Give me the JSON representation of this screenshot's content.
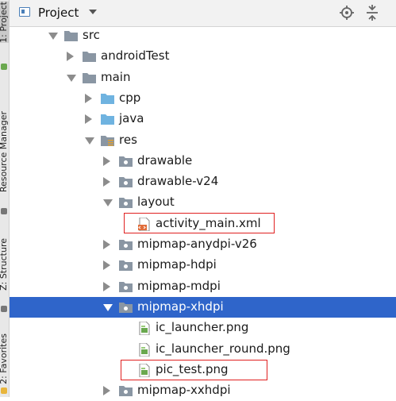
{
  "side_strip": {
    "project_label": "1: Project",
    "resource_label": "Resource Manager",
    "structure_label": "Z: Structure",
    "favorites_label": "2: Favorites"
  },
  "header": {
    "title": "Project",
    "icons": [
      "project-view-icon",
      "dropdown-caret-icon",
      "locate-file-icon",
      "collapse-all-icon"
    ]
  },
  "tree": [
    {
      "label": "src",
      "expanded": true,
      "kind": "folder"
    },
    {
      "label": "androidTest",
      "expanded": false,
      "kind": "folder"
    },
    {
      "label": "main",
      "expanded": true,
      "kind": "folder"
    },
    {
      "label": "cpp",
      "expanded": false,
      "kind": "source-folder"
    },
    {
      "label": "java",
      "expanded": false,
      "kind": "source-folder"
    },
    {
      "label": "res",
      "expanded": true,
      "kind": "resource-folder"
    },
    {
      "label": "drawable",
      "expanded": false,
      "kind": "package"
    },
    {
      "label": "drawable-v24",
      "expanded": false,
      "kind": "package"
    },
    {
      "label": "layout",
      "expanded": true,
      "kind": "package"
    },
    {
      "label": "activity_main.xml",
      "kind": "xml-file"
    },
    {
      "label": "mipmap-anydpi-v26",
      "expanded": false,
      "kind": "package"
    },
    {
      "label": "mipmap-hdpi",
      "expanded": false,
      "kind": "package"
    },
    {
      "label": "mipmap-mdpi",
      "expanded": false,
      "kind": "package"
    },
    {
      "label": "mipmap-xhdpi",
      "expanded": true,
      "kind": "package",
      "selected": true
    },
    {
      "label": "ic_launcher.png",
      "kind": "image-file"
    },
    {
      "label": "ic_launcher_round.png",
      "kind": "image-file"
    },
    {
      "label": "pic_test.png",
      "kind": "image-file"
    },
    {
      "label": "mipmap-xxhdpi",
      "expanded": false,
      "kind": "package"
    }
  ],
  "colors": {
    "selection": "#2f65ca",
    "highlight_box": "#e02020",
    "folder": "#8a96a3",
    "source_folder": "#6fb3e0"
  }
}
